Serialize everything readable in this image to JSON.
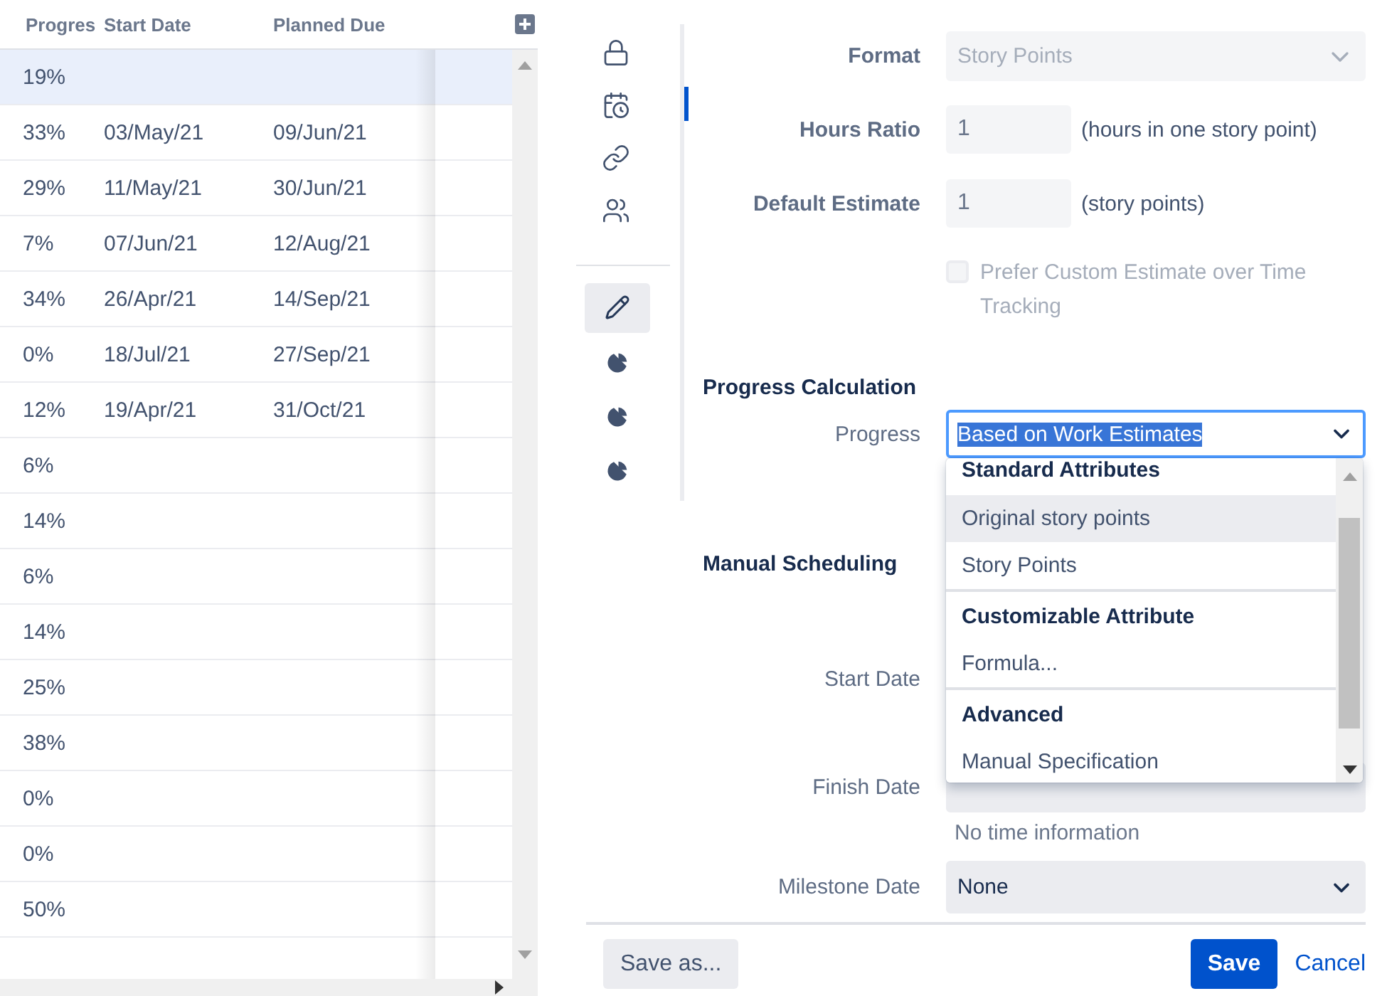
{
  "grid": {
    "columns": [
      "Progres",
      "Start Date",
      "Planned Due"
    ],
    "rows": [
      {
        "progress": "19%",
        "selected": true
      },
      {
        "progress": "33%",
        "start": "03/May/21",
        "due": "09/Jun/21",
        "selected": false
      },
      {
        "progress": "29%",
        "start": "11/May/21",
        "due": "30/Jun/21",
        "selected": false
      },
      {
        "progress": "7%",
        "start": "07/Jun/21",
        "due": "12/Aug/21",
        "selected": false
      },
      {
        "progress": "34%",
        "start": "26/Apr/21",
        "due": "14/Sep/21",
        "selected": false
      },
      {
        "progress": "0%",
        "start": "18/Jul/21",
        "due": "27/Sep/21",
        "selected": false
      },
      {
        "progress": "12%",
        "start": "19/Apr/21",
        "due": "31/Oct/21",
        "selected": false
      },
      {
        "progress": "6%",
        "selected": false
      },
      {
        "progress": "14%",
        "selected": false
      },
      {
        "progress": "6%",
        "selected": false
      },
      {
        "progress": "14%",
        "selected": false
      },
      {
        "progress": "25%",
        "selected": false
      },
      {
        "progress": "38%",
        "selected": false
      },
      {
        "progress": "0%",
        "selected": false
      },
      {
        "progress": "0%",
        "selected": false
      },
      {
        "progress": "50%",
        "selected": false
      }
    ]
  },
  "sidebar": {
    "top_items": [
      {
        "kind": "lock",
        "current": false
      },
      {
        "kind": "calendar",
        "current": true
      },
      {
        "kind": "link",
        "current": false
      },
      {
        "kind": "users",
        "current": false
      }
    ],
    "bottom_items": [
      {
        "kind": "pen",
        "selected": true
      },
      {
        "kind": "pie",
        "selected": false
      },
      {
        "kind": "pie",
        "selected": false
      },
      {
        "kind": "pie",
        "selected": false
      }
    ]
  },
  "form": {
    "format": {
      "label": "Format",
      "value": "Story Points",
      "disabled": true
    },
    "hours_ratio": {
      "label": "Hours Ratio",
      "value": "1",
      "note": "(hours in one story point)"
    },
    "default_estimate": {
      "label": "Default Estimate",
      "value": "1",
      "note": "(story points)"
    },
    "prefer_custom": {
      "label": "Prefer Custom Estimate over Time Tracking",
      "checked": false,
      "disabled": true
    },
    "progress_calculation": {
      "heading": "Progress Calculation",
      "progress": {
        "label": "Progress",
        "value": "Based on Work Estimates",
        "value_highlighted": true,
        "open": true,
        "groups": [
          {
            "heading": "Standard Attributes",
            "options": [
              {
                "label": "Original story points",
                "highlighted": true
              },
              {
                "label": "Story Points",
                "highlighted": false
              }
            ]
          },
          {
            "heading": "Customizable Attribute",
            "options": [
              {
                "label": "Formula...",
                "highlighted": false
              }
            ]
          },
          {
            "heading": "Advanced",
            "options": [
              {
                "label": "Manual Specification",
                "highlighted": false
              }
            ]
          }
        ]
      }
    },
    "manual_scheduling": {
      "heading": "Manual Scheduling",
      "start_date": {
        "label": "Start Date"
      },
      "finish_date": {
        "label": "Finish Date",
        "hint": "No time information"
      },
      "milestone_date": {
        "label": "Milestone Date",
        "value": "None"
      }
    }
  },
  "footer": {
    "save_as": "Save as...",
    "save": "Save",
    "cancel": "Cancel"
  }
}
